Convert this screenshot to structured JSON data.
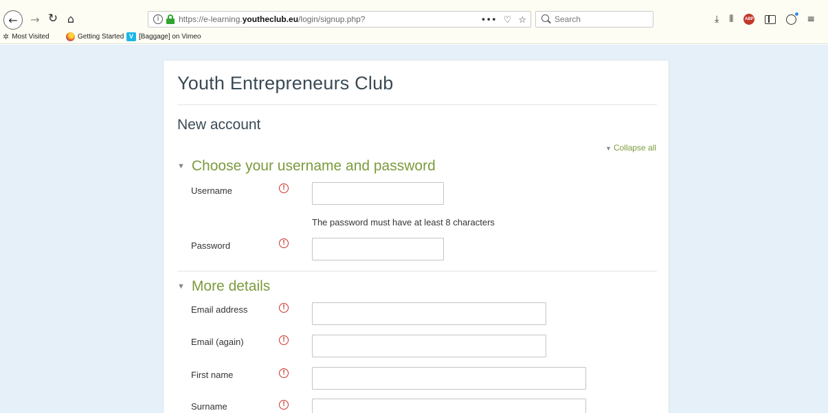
{
  "browser": {
    "url_prefix": "https://e-learning.",
    "url_domain": "youtheclub.eu",
    "url_path": "/login/signup.php?",
    "more_glyph": "•••",
    "pocket_glyph": "♡",
    "star_glyph": "☆",
    "search_placeholder": "Search",
    "back_glyph": "←",
    "forward_glyph": "→",
    "reload_glyph": "↻",
    "home_glyph": "⌂",
    "download_glyph": "⤓",
    "library_glyph": "⦀",
    "abp_label": "ABP",
    "menu_glyph": "≡",
    "bookmarks": [
      {
        "label": "Most Visited",
        "icon": "gear-icon"
      },
      {
        "label": "Getting Started",
        "icon": "firefox-icon"
      },
      {
        "label": "[Baggage] on Vimeo",
        "icon": "vimeo-icon"
      }
    ],
    "vimeo_letter": "V",
    "gear_glyph": "✲"
  },
  "page": {
    "site_title": "Youth Entrepreneurs Club",
    "heading": "New account",
    "collapse_all": "Collapse all",
    "collapse_glyph": "▼",
    "section_glyph": "▼",
    "required_glyph": "!",
    "accent_color": "#7c9a3c",
    "required_color": "#c9302c",
    "sections": [
      {
        "title": "Choose your username and password",
        "fields": [
          {
            "label": "Username",
            "value": ""
          },
          {
            "label": "Password",
            "value": "",
            "hint": "The password must have at least 8 characters"
          }
        ]
      },
      {
        "title": "More details",
        "fields": [
          {
            "label": "Email address",
            "value": ""
          },
          {
            "label": "Email (again)",
            "value": ""
          },
          {
            "label": "First name",
            "value": ""
          },
          {
            "label": "Surname",
            "value": ""
          }
        ]
      }
    ]
  }
}
